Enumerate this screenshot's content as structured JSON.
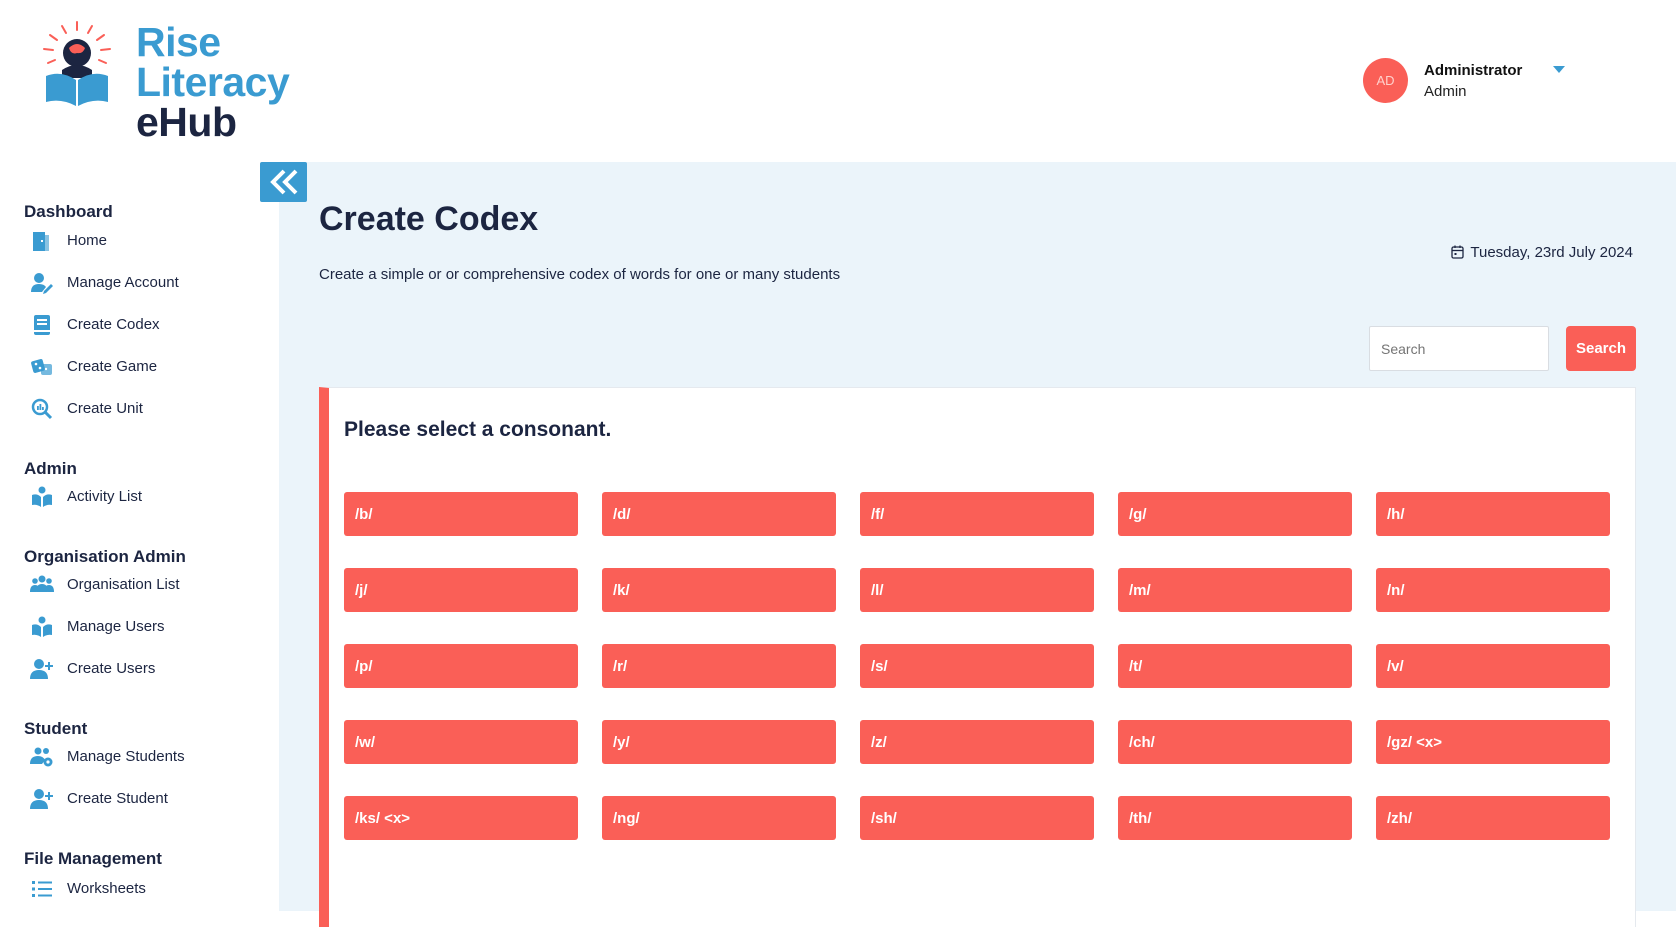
{
  "brand": {
    "line1": "Rise",
    "line2": "Literacy",
    "line3": "eHub"
  },
  "user": {
    "initials": "AD",
    "name": "Administrator",
    "role": "Admin"
  },
  "sidebar": {
    "sections": [
      {
        "title": "Dashboard",
        "items": [
          {
            "label": "Home",
            "icon": "door-icon"
          },
          {
            "label": "Manage Account",
            "icon": "user-edit-icon"
          },
          {
            "label": "Create Codex",
            "icon": "book-icon"
          },
          {
            "label": "Create Game",
            "icon": "dice-icon"
          },
          {
            "label": "Create Unit",
            "icon": "magnify-chart-icon"
          }
        ]
      },
      {
        "title": "Admin",
        "items": [
          {
            "label": "Activity List",
            "icon": "reader-icon"
          }
        ]
      },
      {
        "title": "Organisation Admin",
        "items": [
          {
            "label": "Organisation List",
            "icon": "users-group-icon"
          },
          {
            "label": "Manage Users",
            "icon": "reader-icon"
          },
          {
            "label": "Create Users",
            "icon": "user-plus-icon"
          }
        ]
      },
      {
        "title": "Student",
        "items": [
          {
            "label": "Manage Students",
            "icon": "users-gear-icon"
          },
          {
            "label": "Create Student",
            "icon": "user-plus-icon"
          }
        ]
      },
      {
        "title": "File Management",
        "items": [
          {
            "label": "Worksheets",
            "icon": "list-icon"
          }
        ]
      }
    ]
  },
  "main": {
    "title": "Create Codex",
    "subtitle": "Create a simple or or comprehensive codex of words for one or many students",
    "date": "Tuesday, 23rd July 2024",
    "search": {
      "placeholder": "Search",
      "button": "Search"
    },
    "prompt": "Please select a consonant.",
    "consonants": [
      "/b/",
      "/d/",
      "/f/",
      "/g/",
      "/h/",
      "/j/",
      "/k/",
      "/l/",
      "/m/",
      "/n/",
      "/p/",
      "/r/",
      "/s/",
      "/t/",
      "/v/",
      "/w/",
      "/y/",
      "/z/",
      "/ch/",
      "/gz/ <x>",
      "/ks/ <x>",
      "/ng/",
      "/sh/",
      "/th/",
      "/zh/"
    ]
  },
  "colors": {
    "accent": "#fa5f57",
    "brand_blue": "#3a9bd1",
    "navy": "#1c2541",
    "main_bg": "#ebf4fa"
  }
}
